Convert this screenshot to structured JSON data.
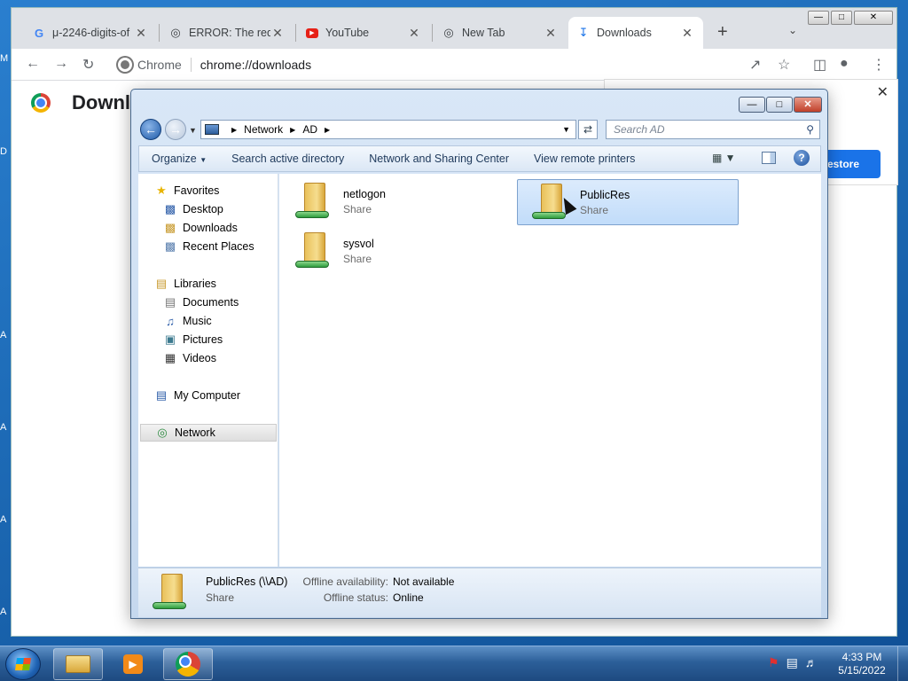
{
  "desktop": {
    "edge_labels": [
      "M",
      "D",
      "A",
      "A",
      "A",
      "A"
    ]
  },
  "browser": {
    "tabs": [
      {
        "title": "μ-2246-digits-of",
        "favicon": "google-icon",
        "active": false
      },
      {
        "title": "ERROR: The requ",
        "favicon": "globe-icon",
        "active": false
      },
      {
        "title": "YouTube",
        "favicon": "youtube-icon",
        "active": false
      },
      {
        "title": "New Tab",
        "favicon": "chrome-icon",
        "active": false
      },
      {
        "title": "Downloads",
        "favicon": "download-icon",
        "active": true
      }
    ],
    "new_tab_label": "+",
    "tab_close": "✕",
    "omnibox": {
      "site_label": "Chrome",
      "url": "chrome://downloads"
    },
    "page_title": "Downlo",
    "restore_label": "estore",
    "side_close": "✕"
  },
  "explorer": {
    "breadcrumb": [
      "Network",
      "AD"
    ],
    "search_placeholder": "Search AD",
    "commands": [
      "Organize",
      "Search active directory",
      "Network and Sharing Center",
      "View remote printers"
    ],
    "nav": {
      "favorites": {
        "label": "Favorites",
        "items": [
          "Desktop",
          "Downloads",
          "Recent Places"
        ]
      },
      "libraries": {
        "label": "Libraries",
        "items": [
          "Documents",
          "Music",
          "Pictures",
          "Videos"
        ]
      },
      "computer": "My Computer",
      "network": "Network"
    },
    "items": [
      {
        "name": "netlogon",
        "type": "Share",
        "selected": false
      },
      {
        "name": "PublicRes",
        "type": "Share",
        "selected": true
      },
      {
        "name": "sysvol",
        "type": "Share",
        "selected": false
      }
    ],
    "details": {
      "name": "PublicRes (\\\\AD)",
      "type": "Share",
      "offline_availability_label": "Offline availability:",
      "offline_availability_value": "Not available",
      "offline_status_label": "Offline status:",
      "offline_status_value": "Online"
    }
  },
  "taskbar": {
    "clock_time": "4:33 PM",
    "clock_date": "5/15/2022"
  }
}
